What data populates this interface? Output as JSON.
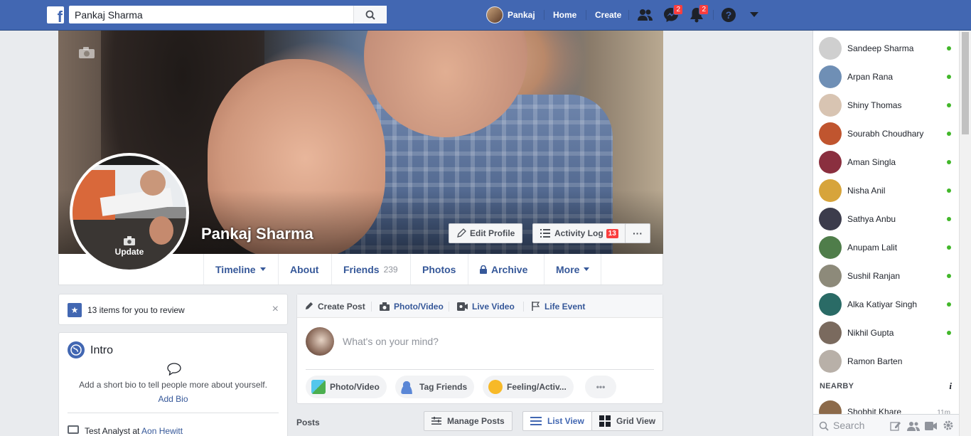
{
  "header": {
    "search_value": "Pankaj Sharma",
    "profile_name": "Pankaj",
    "home": "Home",
    "create": "Create",
    "messages_badge": "2",
    "notifications_badge": "2"
  },
  "profile": {
    "name": "Pankaj Sharma",
    "update_label": "Update",
    "edit_profile": "Edit Profile",
    "activity_log": "Activity Log",
    "activity_count": "13",
    "more_dots": "···"
  },
  "tabs": [
    {
      "label": "Timeline"
    },
    {
      "label": "About"
    },
    {
      "label": "Friends",
      "count": "239"
    },
    {
      "label": "Photos"
    },
    {
      "label": "Archive"
    },
    {
      "label": "More"
    }
  ],
  "review": {
    "text": "13 items for you to review",
    "close": "×"
  },
  "intro": {
    "title": "Intro",
    "bio_prompt": "Add a short bio to tell people more about yourself.",
    "add_bio": "Add Bio",
    "job_prefix": "Test Analyst at ",
    "job_company": "Aon Hewitt"
  },
  "composer": {
    "create_post": "Create Post",
    "photo_video": "Photo/Video",
    "live_video": "Live Video",
    "life_event": "Life Event",
    "placeholder": "What's on your mind?",
    "actions": [
      "Photo/Video",
      "Tag Friends",
      "Feeling/Activ...",
      "•••"
    ]
  },
  "posts": {
    "label": "Posts",
    "manage": "Manage Posts",
    "list_view": "List View",
    "grid_view": "Grid View"
  },
  "chat": {
    "contacts": [
      {
        "name": "Sandeep Sharma",
        "color": "#cfcfcf"
      },
      {
        "name": "Arpan Rana",
        "color": "#6f8fb5"
      },
      {
        "name": "Shiny Thomas",
        "color": "#d8c4b2"
      },
      {
        "name": "Sourabh Choudhary",
        "color": "#c0552f"
      },
      {
        "name": "Aman Singla",
        "color": "#8a2f3f"
      },
      {
        "name": "Nisha Anil",
        "color": "#d7a43b"
      },
      {
        "name": "Sathya Anbu",
        "color": "#3c3c4c"
      },
      {
        "name": "Anupam Lalit",
        "color": "#4f7d4a"
      },
      {
        "name": "Sushil Ranjan",
        "color": "#8d8a7a"
      },
      {
        "name": "Alka Katiyar Singh",
        "color": "#2a6b66"
      },
      {
        "name": "Nikhil Gupta",
        "color": "#7a6a5e"
      },
      {
        "name": "Ramon Barten",
        "color": "#b8b0a8"
      }
    ],
    "nearby_label": "NEARBY",
    "nearby_info": "i",
    "nearby_contact": "Shobhit Khare",
    "nearby_time": "11m",
    "search_placeholder": "Search"
  }
}
